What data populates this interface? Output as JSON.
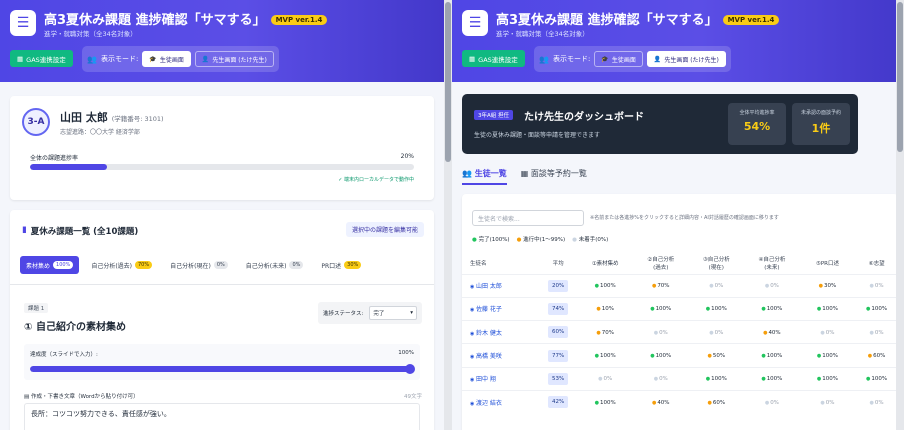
{
  "header": {
    "title": "高3夏休み課題 進捗確認「サマする」",
    "version": "MVP ver.1.4",
    "subtitle": "進学・就職対策（全34名対象）",
    "gas_button": "GAS連携設定",
    "mode_label": "表示モード:",
    "student_view": "生徒画面",
    "teacher_view": "先生画面 (たけ先生)"
  },
  "student": {
    "class_badge": "3-A",
    "name": "山田 太郎",
    "id_text": "(学籍番号: 3101)",
    "goal": "志望進路：〇〇大学 経済学部",
    "overall_label": "全体の課題進捗率",
    "overall_value": "20%",
    "overall_fraction": 0.2,
    "save_note": "✓ 端末内ローカルデータで動作中"
  },
  "tasks": {
    "section_title": "夏休み課題一覧 (全10課題)",
    "edit_button": "選択中の課題を編集可能",
    "tabs": [
      {
        "label": "素材集め",
        "pct": "100%"
      },
      {
        "label": "自己分析(過去)",
        "pct": "70%"
      },
      {
        "label": "自己分析(現在)",
        "pct": "0%"
      },
      {
        "label": "自己分析(未来)",
        "pct": "0%"
      },
      {
        "label": "PR口述",
        "pct": "30%"
      }
    ],
    "task_no": "課題 1",
    "task_title": "① 自己紹介の素材集め",
    "status_label": "進捗ステータス:",
    "status_value": "完了",
    "progress_label": "達成度（スライドで入力）:",
    "progress_value": "100%",
    "progress_fraction": 1.0,
    "draft_label": "作成・下書き文章（Wordから貼り付け可）",
    "char_count": "49文字",
    "draft_text": "長所：コツコツ努力できる、責任感が強い。"
  },
  "teacher": {
    "badge": "3年A組 担任",
    "title": "たけ先生のダッシュボード",
    "desc": "生徒の夏休み課題・面談等申請を管理できます",
    "stat1_label": "全体平均進捗率",
    "stat1_value": "54%",
    "stat2_label": "未承認の面談予約",
    "stat2_value": "1件",
    "tab_students": "生徒一覧",
    "tab_interview": "面談等予約一覧",
    "search_placeholder": "生徒名で検索...",
    "hint": "※名前または各進捗%をクリックすると詳細内容・AI対話履歴の確認画面に移ります",
    "legend": [
      "完了(100%)",
      "進行中(1〜99%)",
      "未着手(0%)"
    ],
    "columns": [
      "生徒名",
      "平均",
      "①素材集め",
      "②自己分析\n(過去)",
      "③自己分析\n(現在)",
      "④自己分析\n(未来)",
      "⑤PR口述",
      "⑥志望"
    ],
    "rows": [
      {
        "name": "山田 太郎",
        "avg": "20%",
        "cells": [
          "100%",
          "70%",
          "0%",
          "0%",
          "30%",
          "0%"
        ]
      },
      {
        "name": "佐藤 花子",
        "avg": "74%",
        "cells": [
          "10%",
          "100%",
          "100%",
          "100%",
          "100%",
          "100%"
        ]
      },
      {
        "name": "鈴木 健太",
        "avg": "60%",
        "cells": [
          "70%",
          "0%",
          "0%",
          "40%",
          "0%",
          "0%"
        ]
      },
      {
        "name": "高橋 美咲",
        "avg": "77%",
        "cells": [
          "100%",
          "100%",
          "50%",
          "100%",
          "100%",
          "60%"
        ]
      },
      {
        "name": "田中 翔",
        "avg": "53%",
        "cells": [
          "0%",
          "0%",
          "100%",
          "100%",
          "100%",
          "100%"
        ]
      },
      {
        "name": "渡辺 結衣",
        "avg": "42%",
        "cells": [
          "100%",
          "40%",
          "60%",
          "0%",
          "0%",
          "0%"
        ]
      }
    ]
  },
  "colors": {
    "accent": "#4f46e5",
    "green": "#10b981",
    "yellow": "#facc15",
    "orange": "#f59e0b"
  }
}
